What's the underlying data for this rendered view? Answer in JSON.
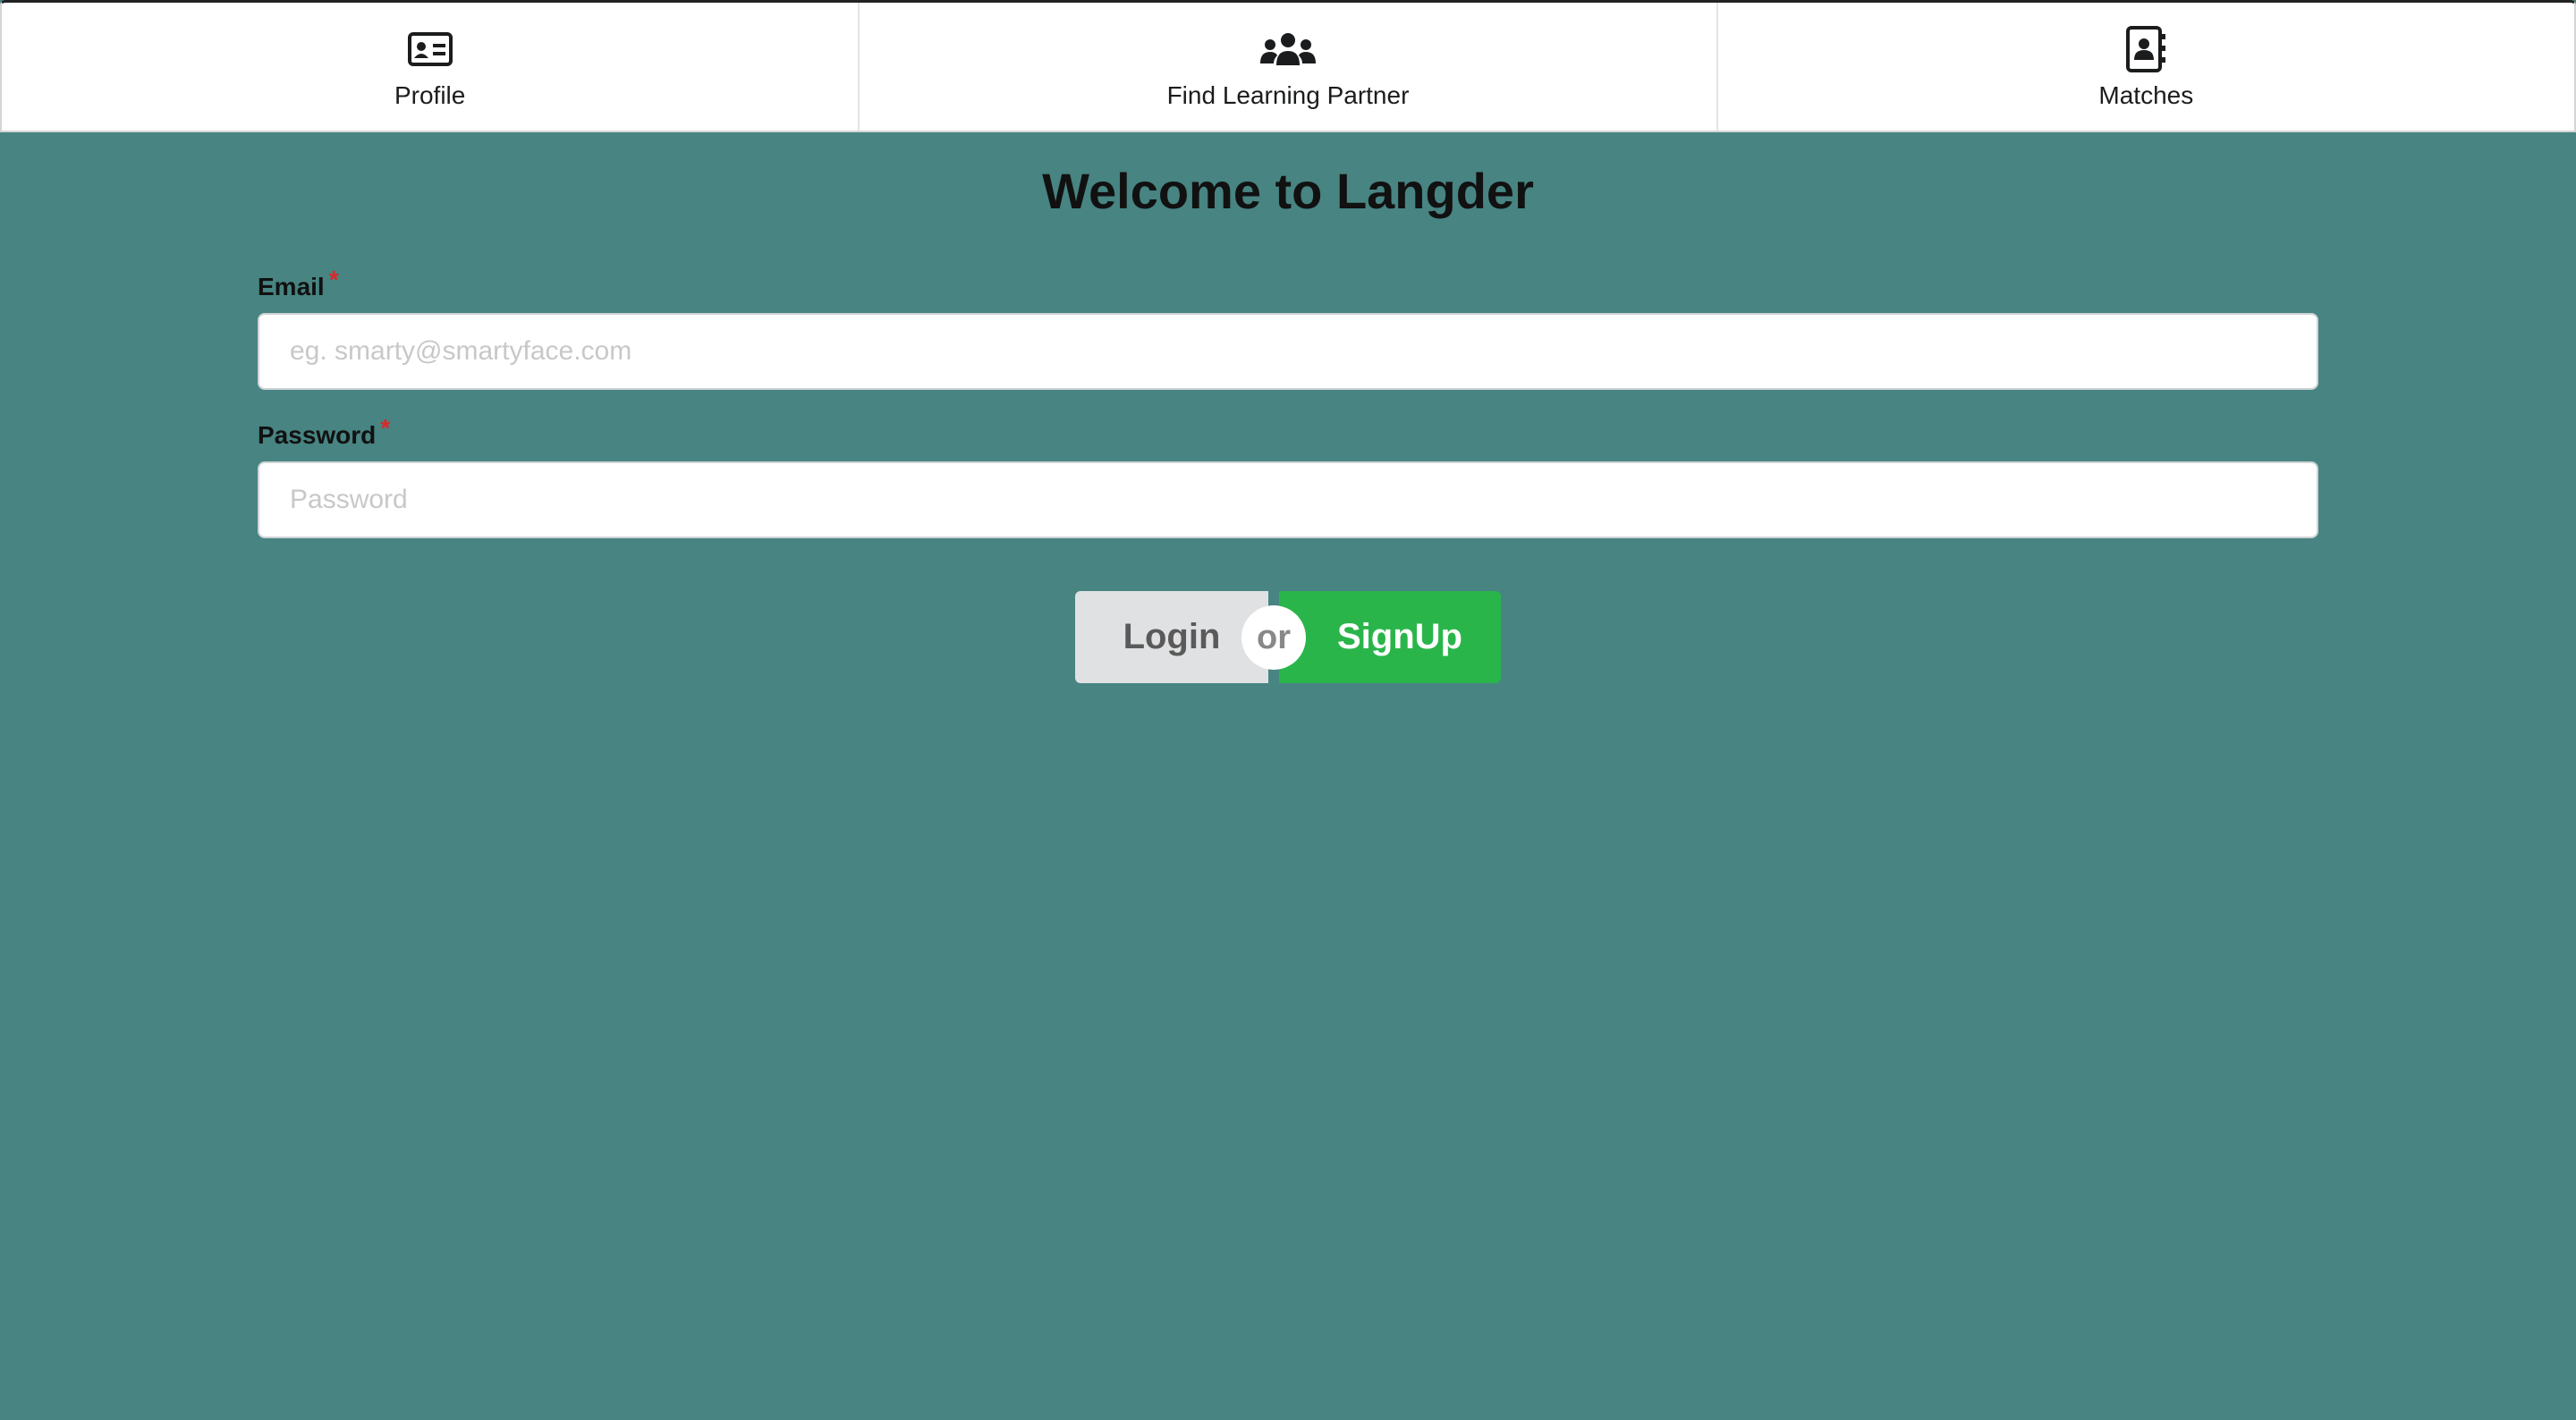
{
  "nav": {
    "items": [
      {
        "label": "Profile",
        "icon": "id-card-icon"
      },
      {
        "label": "Find Learning Partner",
        "icon": "users-icon"
      },
      {
        "label": "Matches",
        "icon": "address-book-icon"
      }
    ]
  },
  "main": {
    "title": "Welcome to Langder"
  },
  "form": {
    "email": {
      "label": "Email",
      "required_mark": "*",
      "placeholder": "eg. smarty@smartyface.com",
      "value": ""
    },
    "password": {
      "label": "Password",
      "required_mark": "*",
      "placeholder": "Password",
      "value": ""
    },
    "buttons": {
      "login_label": "Login",
      "or_label": "or",
      "signup_label": "SignUp"
    }
  },
  "colors": {
    "background": "#478482",
    "signup": "#2ab54b",
    "login": "#e0e1e2",
    "required": "#db2828"
  }
}
